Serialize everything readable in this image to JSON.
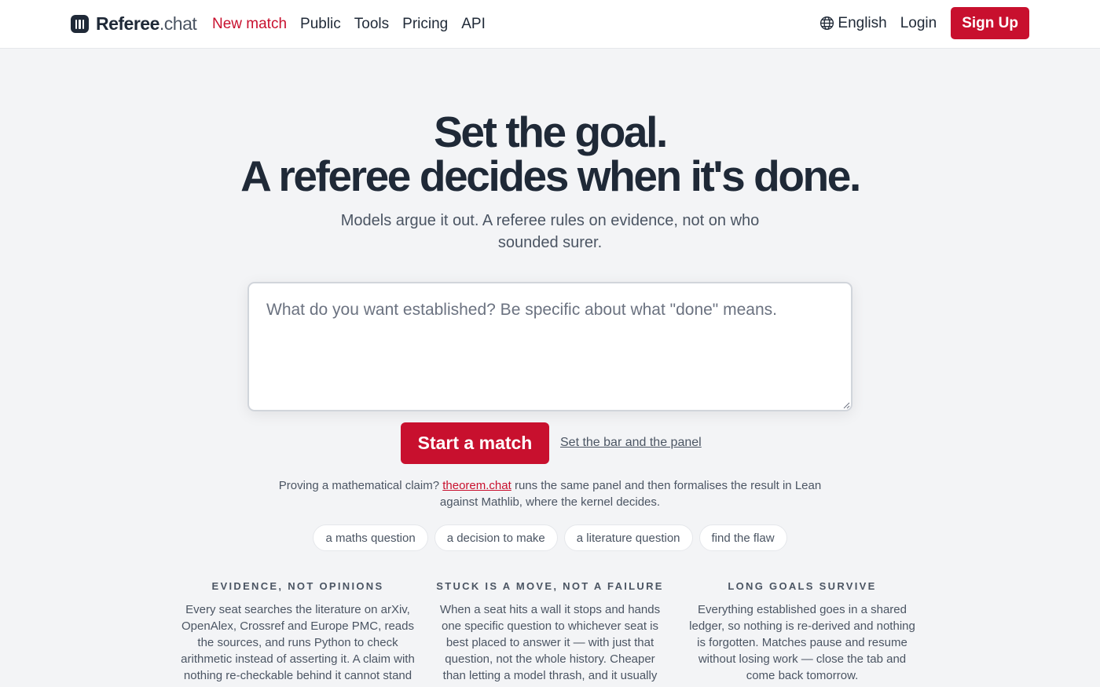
{
  "header": {
    "brand": {
      "name": "Referee",
      "tld": ".chat"
    },
    "nav": [
      {
        "label": "New match",
        "active": true
      },
      {
        "label": "Public",
        "active": false
      },
      {
        "label": "Tools",
        "active": false
      },
      {
        "label": "Pricing",
        "active": false
      },
      {
        "label": "API",
        "active": false
      }
    ],
    "language": "English",
    "login": "Login",
    "signup": "Sign Up"
  },
  "hero": {
    "title_line1": "Set the goal.",
    "title_line2": "A referee decides when it's done.",
    "subtitle": "Models argue it out. A referee rules on evidence, not on who sounded surer."
  },
  "goal_input": {
    "placeholder": "What do you want established? Be specific about what \"done\" means.",
    "value": ""
  },
  "actions": {
    "start": "Start a match",
    "settings": "Set the bar and the panel"
  },
  "math_note": {
    "prefix": "Proving a mathematical claim?",
    "link": "theorem.chat",
    "suffix": "runs the same panel and then formalises the result in Lean against Mathlib, where the kernel decides."
  },
  "examples": [
    "a maths question",
    "a decision to make",
    "a literature question",
    "find the flaw"
  ],
  "features": [
    {
      "title": "EVIDENCE, NOT OPINIONS",
      "body": "Every seat searches the literature on arXiv, OpenAlex, Crossref and Europe PMC, reads the sources, and runs Python to check arithmetic instead of asserting it. A claim with nothing re-checkable behind it cannot stand on its own."
    },
    {
      "title": "STUCK IS A MOVE, NOT A FAILURE",
      "body": "When a seat hits a wall it stops and hands one specific question to whichever seat is best placed to answer it — with just that question, not the whole history. Cheaper than letting a model thrash, and it usually gets unblocked."
    },
    {
      "title": "LONG GOALS SURVIVE",
      "body": "Everything established goes in a shared ledger, so nothing is re-derived and nothing is forgotten. Matches pause and resume without losing work — close the tab and come back tomorrow."
    }
  ],
  "colors": {
    "accent": "#c8102e",
    "background": "#f3f4f6",
    "text": "#1f2937"
  }
}
